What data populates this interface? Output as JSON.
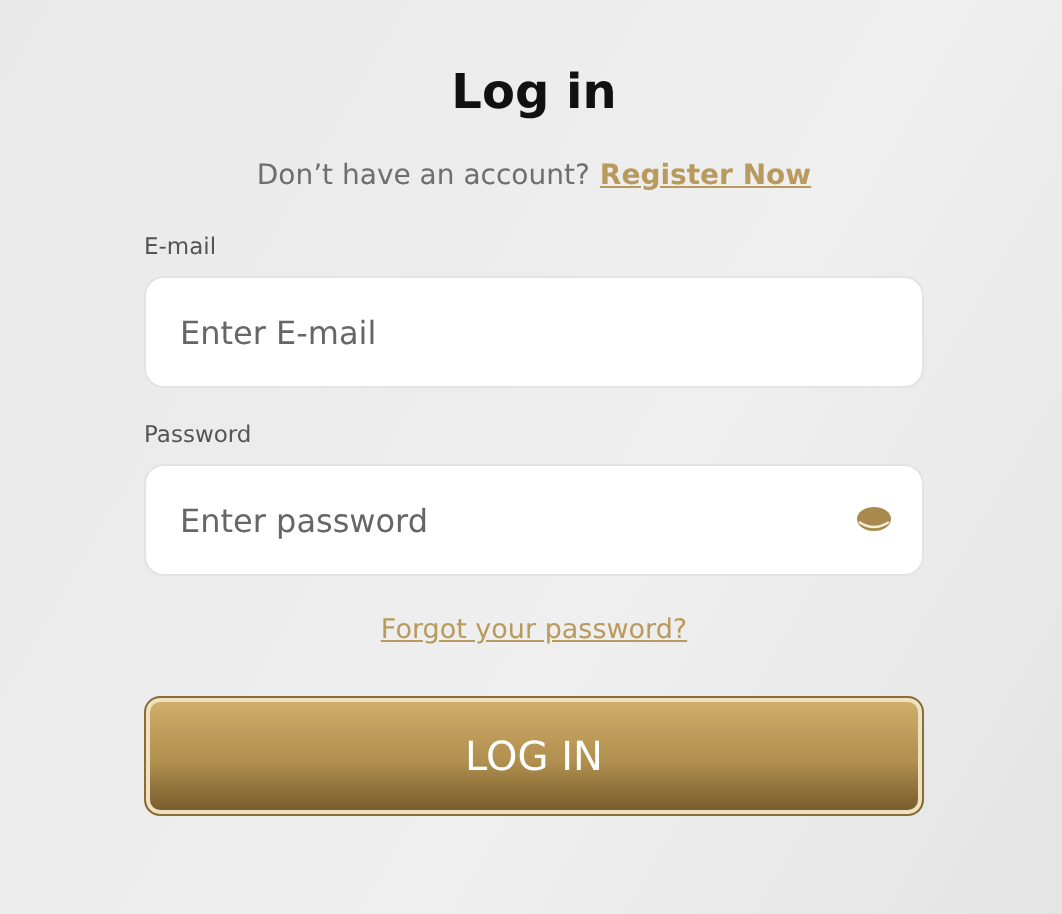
{
  "title": "Log in",
  "register_prompt": {
    "text": "Don’t have an account?",
    "link": "Register Now"
  },
  "fields": [
    {
      "label": "E-mail",
      "placeholder": "Enter E-mail",
      "kind": "text"
    },
    {
      "label": "Password",
      "placeholder": "Enter password",
      "kind": "password"
    }
  ],
  "forgot_link": "Forgot your password?",
  "submit_button": "LOG IN"
}
